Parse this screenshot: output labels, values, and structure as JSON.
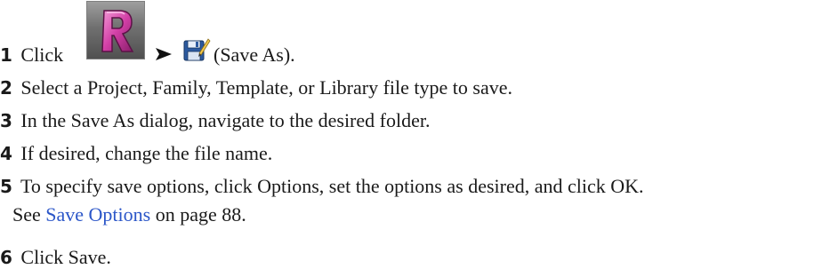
{
  "steps": [
    {
      "num": "1",
      "text": "Click"
    },
    {
      "num": "2",
      "text": "Select a Project, Family, Template, or Library file type to save."
    },
    {
      "num": "3",
      "text": "In the Save As dialog, navigate to the desired folder."
    },
    {
      "num": "4",
      "text": "If desired, change the file name."
    },
    {
      "num": "5",
      "text": "To specify save options, click Options, set the options as desired, and click OK."
    },
    {
      "num": "6",
      "text": "Click Save."
    }
  ],
  "step1_icon_caption": "(Save As).",
  "app_icon": "revit-r-icon",
  "menu_arrow": "➤",
  "save_as_icon": "save-as-icon",
  "see_also": {
    "prefix": "See",
    "link_text": "Save Options",
    "suffix": "on page 88."
  },
  "colors": {
    "link": "#2b56c8",
    "icon_magenta": "#d23fa6"
  }
}
